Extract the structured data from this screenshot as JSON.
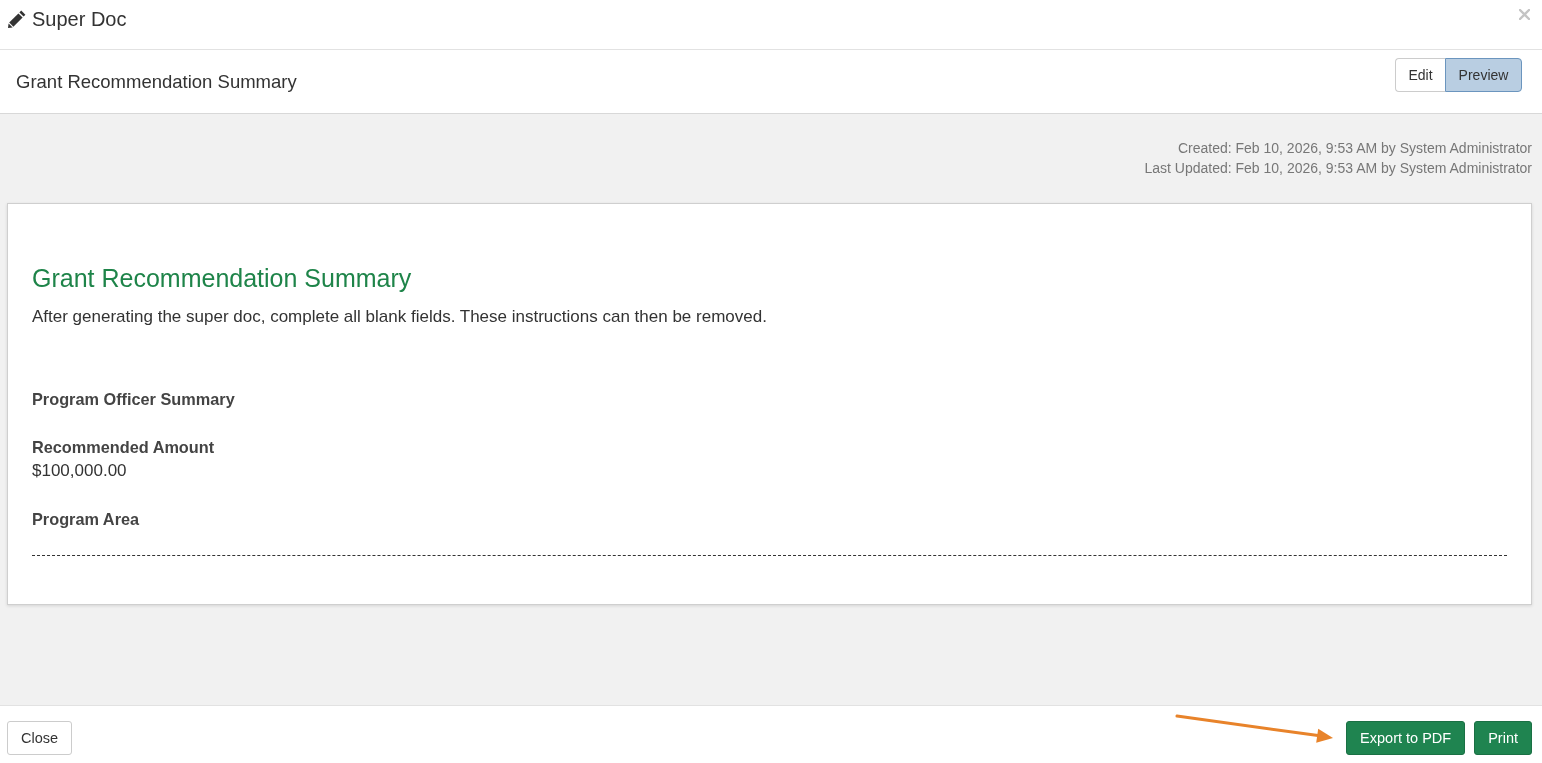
{
  "window": {
    "title": "Super Doc"
  },
  "document_header": {
    "title": "Grant Recommendation Summary",
    "modes": [
      {
        "label": "Edit",
        "selected": false
      },
      {
        "label": "Preview",
        "selected": true
      }
    ]
  },
  "meta": [
    "Created: Feb 10, 2026, 9:53 AM by System Administrator",
    "Last Updated: Feb 10, 2026, 9:53 AM by System Administrator"
  ],
  "document": {
    "heading": "Grant Recommendation Summary",
    "instructions": "After generating the super doc, complete all blank fields. These instructions can then be removed.",
    "fields": [
      {
        "label": "Program Officer Summary"
      },
      {
        "label": "Recommended Amount",
        "value": "$100,000.00"
      },
      {
        "label": "Program Area"
      }
    ]
  },
  "footer": {
    "buttons": [
      {
        "label": "Close",
        "kind": "secondary"
      },
      {
        "label": "Export to PDF",
        "kind": "primary"
      },
      {
        "label": "Print",
        "kind": "primary"
      }
    ]
  },
  "annotation": {
    "kind": "arrow"
  }
}
